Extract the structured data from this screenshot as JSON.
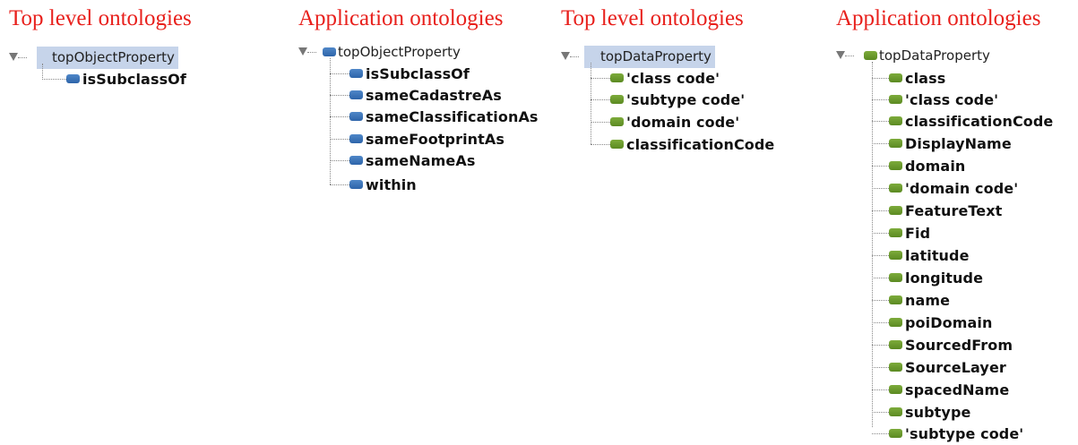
{
  "panels": [
    {
      "title": "Top level ontologies",
      "kind": "object",
      "root": "topObjectProperty",
      "children": [
        "isSubclassOf"
      ]
    },
    {
      "title": "Application ontologies",
      "kind": "object",
      "root": "topObjectProperty",
      "children": [
        "isSubclassOf",
        "sameCadastreAs",
        "sameClassificationAs",
        "sameFootprintAs",
        "sameNameAs",
        "within"
      ]
    },
    {
      "title": "Top level ontologies",
      "kind": "data",
      "root": "topDataProperty",
      "children": [
        "'class code'",
        "'subtype code'",
        "'domain code'",
        "classificationCode"
      ]
    },
    {
      "title": "Application ontologies",
      "kind": "data",
      "root": "topDataProperty",
      "children": [
        "class",
        "'class code'",
        "classificationCode",
        "DisplayName",
        "domain",
        "'domain code'",
        "FeatureText",
        "Fid",
        "latitude",
        "longitude",
        "name",
        "poiDomain",
        "SourcedFrom",
        "SourceLayer",
        "spacedName",
        "subtype",
        "'subtype code'"
      ]
    }
  ],
  "colors": {
    "title": "#e8201c",
    "object_property": "#3a74bd",
    "data_property": "#6a9a2e",
    "selection": "#c6d4ea"
  },
  "icons": {
    "expand": "triangle-down-icon",
    "object": "object-property-icon",
    "data": "data-property-icon"
  }
}
